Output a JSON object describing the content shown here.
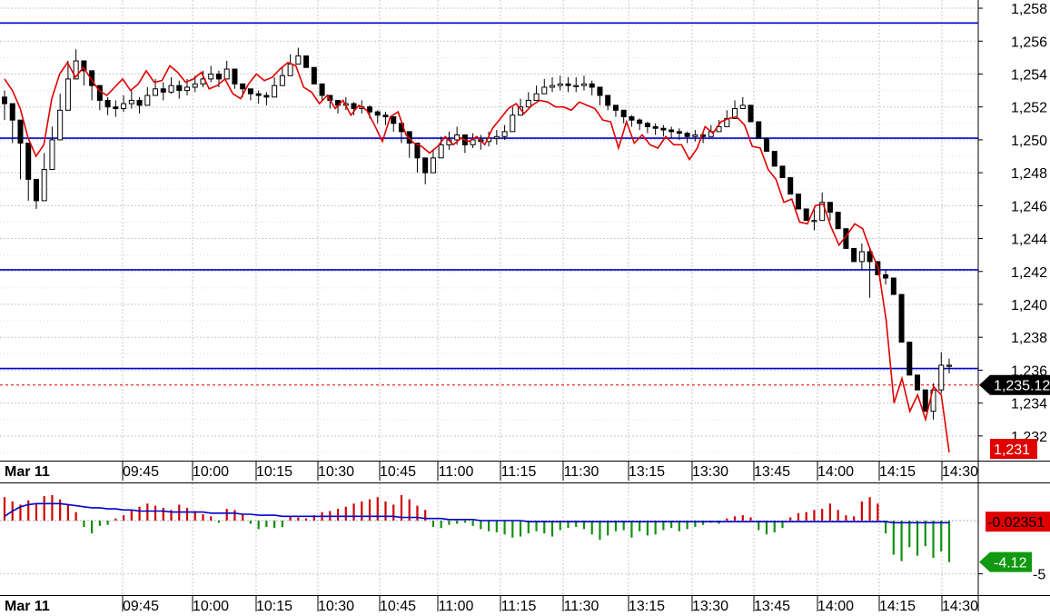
{
  "chart_data": [
    {
      "type": "candlestick",
      "panel": "price",
      "ylim": [
        1.2305,
        1.2585
      ],
      "y_ticks": [
        "1,232",
        "1,234",
        "1,236",
        "1,238",
        "1,240",
        "1,242",
        "1,244",
        "1,246",
        "1,248",
        "1,250",
        "1,252",
        "1,254",
        "1,256",
        "1,258"
      ],
      "y_tick_values": [
        1.232,
        1.234,
        1.236,
        1.238,
        1.24,
        1.242,
        1.244,
        1.246,
        1.248,
        1.25,
        1.252,
        1.254,
        1.256,
        1.258
      ],
      "x_date_label": "Mar 11",
      "x_ticks": [
        "09:45",
        "10:00",
        "10:15",
        "10:30",
        "10:45",
        "11:00",
        "11:15",
        "11:30",
        "13:15",
        "13:30",
        "13:45",
        "14:00",
        "14:15",
        "14:30"
      ],
      "grid": true,
      "horizontal_levels": [
        1.2571,
        1.2501,
        1.2421,
        1.2361
      ],
      "current_price_line": 1.2351,
      "price_badge": "1,235.12",
      "red_badge": "1,231",
      "colors": {
        "level_lines": "#0000cc",
        "overlay_line": "#e00000",
        "badge_dark": "#000000",
        "badge_red": "#e00000",
        "grid": "#c8c8c8"
      },
      "series": [
        {
          "kind": "candles",
          "close": [
            1.2522,
            1.2512,
            1.2498,
            1.2476,
            1.2463,
            1.2482,
            1.25,
            1.2518,
            1.2537,
            1.2548,
            1.2542,
            1.2533,
            1.2524,
            1.252,
            1.2519,
            1.2522,
            1.2524,
            1.2521,
            1.2527,
            1.2531,
            1.2529,
            1.2533,
            1.253,
            1.2532,
            1.2534,
            1.2537,
            1.254,
            1.2537,
            1.2543,
            1.2534,
            1.2531,
            1.2528,
            1.2527,
            1.2526,
            1.2533,
            1.2539,
            1.2546,
            1.2551,
            1.2544,
            1.2534,
            1.2527,
            1.2524,
            1.2521,
            1.2522,
            1.2519,
            1.252,
            1.2517,
            1.2515,
            1.2514,
            1.251,
            1.2505,
            1.2498,
            1.2489,
            1.248,
            1.2489,
            1.2497,
            1.25,
            1.2503,
            1.2497,
            1.25,
            1.2499,
            1.2501,
            1.2502,
            1.2505,
            1.2515,
            1.252,
            1.2524,
            1.2528,
            1.2532,
            1.2533,
            1.2534,
            1.2533,
            1.2533,
            1.2534,
            1.2532,
            1.2527,
            1.2521,
            1.2518,
            1.2514,
            1.2512,
            1.251,
            1.2508,
            1.2507,
            1.2506,
            1.2505,
            1.2504,
            1.2502,
            1.2503,
            1.2502,
            1.2505,
            1.2508,
            1.2513,
            1.2519,
            1.2521,
            1.2511,
            1.2501,
            1.2493,
            1.2484,
            1.2477,
            1.2467,
            1.2458,
            1.2451,
            1.2451,
            1.2462,
            1.2456,
            1.2446,
            1.2434,
            1.2426,
            1.2432,
            1.2426,
            1.2418,
            1.2416,
            1.2406,
            1.2377,
            1.2357,
            1.2348,
            1.2335,
            1.2348,
            1.2363,
            1.2363
          ],
          "high": [
            1.253,
            1.2522,
            1.2512,
            1.2498,
            1.2476,
            1.2492,
            1.2508,
            1.2528,
            1.2548,
            1.2555,
            1.2548,
            1.2542,
            1.2533,
            1.2526,
            1.2524,
            1.2527,
            1.253,
            1.2526,
            1.2532,
            1.2537,
            1.2535,
            1.2538,
            1.2536,
            1.2537,
            1.2539,
            1.2542,
            1.2545,
            1.2542,
            1.2548,
            1.2543,
            1.2534,
            1.2531,
            1.253,
            1.2529,
            1.2538,
            1.2544,
            1.2552,
            1.2556,
            1.2551,
            1.2544,
            1.2534,
            1.2527,
            1.2524,
            1.2526,
            1.2523,
            1.2524,
            1.2521,
            1.2518,
            1.2517,
            1.2514,
            1.251,
            1.2505,
            1.2498,
            1.2489,
            1.2494,
            1.2502,
            1.2505,
            1.2508,
            1.2503,
            1.2504,
            1.2503,
            1.2505,
            1.2506,
            1.2509,
            1.252,
            1.2525,
            1.2529,
            1.2533,
            1.2537,
            1.2538,
            1.2539,
            1.2538,
            1.2538,
            1.2539,
            1.2536,
            1.2532,
            1.2527,
            1.2521,
            1.2518,
            1.2515,
            1.2513,
            1.2511,
            1.251,
            1.2509,
            1.2508,
            1.2507,
            1.2505,
            1.2506,
            1.2505,
            1.2509,
            1.2512,
            1.2518,
            1.2524,
            1.2526,
            1.2521,
            1.2511,
            1.2501,
            1.2493,
            1.2484,
            1.2477,
            1.2467,
            1.2458,
            1.2458,
            1.2468,
            1.2462,
            1.2456,
            1.2446,
            1.2434,
            1.2437,
            1.2434,
            1.2426,
            1.2421,
            1.2416,
            1.2406,
            1.2377,
            1.2357,
            1.2348,
            1.2352,
            1.2371,
            1.2367
          ],
          "low": [
            1.2512,
            1.2498,
            1.2476,
            1.2463,
            1.2458,
            1.2463,
            1.2482,
            1.25,
            1.2518,
            1.2537,
            1.2533,
            1.2524,
            1.2518,
            1.2515,
            1.2514,
            1.2517,
            1.2519,
            1.2516,
            1.2521,
            1.2527,
            1.2524,
            1.2528,
            1.2525,
            1.2527,
            1.2529,
            1.2532,
            1.2535,
            1.2532,
            1.2537,
            1.2531,
            1.2526,
            1.2524,
            1.2522,
            1.2521,
            1.2526,
            1.2533,
            1.2539,
            1.2546,
            1.2544,
            1.2534,
            1.2524,
            1.2519,
            1.2516,
            1.2518,
            1.2515,
            1.2516,
            1.2513,
            1.251,
            1.2509,
            1.2505,
            1.2498,
            1.2489,
            1.248,
            1.2473,
            1.248,
            1.2489,
            1.2494,
            1.2497,
            1.2492,
            1.2495,
            1.2494,
            1.2496,
            1.2497,
            1.25,
            1.2505,
            1.2515,
            1.252,
            1.2524,
            1.2528,
            1.2529,
            1.253,
            1.2529,
            1.2529,
            1.253,
            1.2527,
            1.2521,
            1.2518,
            1.2514,
            1.251,
            1.2508,
            1.2506,
            1.2504,
            1.2503,
            1.2502,
            1.2501,
            1.25,
            1.2498,
            1.2499,
            1.2498,
            1.2502,
            1.2505,
            1.2508,
            1.2513,
            1.2519,
            1.2511,
            1.2501,
            1.2493,
            1.2484,
            1.2477,
            1.2467,
            1.2458,
            1.2451,
            1.2445,
            1.2451,
            1.2451,
            1.2446,
            1.2434,
            1.2426,
            1.2421,
            1.2404,
            1.2418,
            1.2412,
            1.2406,
            1.2377,
            1.2357,
            1.2348,
            1.2335,
            1.233,
            1.2346,
            1.2358
          ]
        },
        {
          "kind": "line",
          "values": [
            1.2537,
            1.253,
            1.2519,
            1.2501,
            1.249,
            1.2497,
            1.2525,
            1.254,
            1.2547,
            1.2538,
            1.2544,
            1.2537,
            1.253,
            1.2527,
            1.2532,
            1.2537,
            1.253,
            1.2534,
            1.2542,
            1.2535,
            1.2536,
            1.2545,
            1.2541,
            1.2535,
            1.2537,
            1.2541,
            1.2531,
            1.2533,
            1.2537,
            1.2528,
            1.2525,
            1.2534,
            1.254,
            1.2536,
            1.2538,
            1.2543,
            1.2547,
            1.2545,
            1.2532,
            1.2529,
            1.2522,
            1.2527,
            1.2519,
            1.2524,
            1.2515,
            1.2521,
            1.2518,
            1.2509,
            1.2499,
            1.2514,
            1.2517,
            1.2503,
            1.2498,
            1.2496,
            1.2492,
            1.2496,
            1.2502,
            1.2497,
            1.2501,
            1.2499,
            1.2502,
            1.2497,
            1.2507,
            1.2513,
            1.2519,
            1.2522,
            1.2516,
            1.2521,
            1.2524,
            1.2523,
            1.252,
            1.252,
            1.2518,
            1.2523,
            1.2521,
            1.2519,
            1.2512,
            1.2511,
            1.2495,
            1.2511,
            1.2498,
            1.2503,
            1.2497,
            1.2495,
            1.2502,
            1.2497,
            1.2497,
            1.2488,
            1.2495,
            1.2508,
            1.2504,
            1.2511,
            1.2513,
            1.2514,
            1.2509,
            1.2496,
            1.2495,
            1.2482,
            1.2476,
            1.2462,
            1.2464,
            1.245,
            1.2449,
            1.246,
            1.2461,
            1.2447,
            1.2436,
            1.2442,
            1.2449,
            1.2446,
            1.2433,
            1.2422,
            1.239,
            1.234,
            1.2355,
            1.2335,
            1.2345,
            1.233,
            1.235,
            1.2345,
            1.231
          ]
        }
      ]
    },
    {
      "type": "bar",
      "panel": "indicator",
      "ylim": [
        -7,
        3.5
      ],
      "y_ticks": [
        "-5"
      ],
      "y_tick_values": [
        -5
      ],
      "badges": [
        "-0.02351",
        "-4.12"
      ],
      "colors": {
        "positive": "#d00000",
        "negative": "#109010",
        "signal_line": "#0000cc",
        "badge_red": "#e00000",
        "badge_green": "#119911"
      },
      "x_date_label": "Mar 11",
      "x_ticks": [
        "09:45",
        "10:00",
        "10:15",
        "10:30",
        "10:45",
        "11:00",
        "11:15",
        "11:30",
        "13:15",
        "13:30",
        "13:45",
        "14:00",
        "14:15",
        "14:30"
      ],
      "values": [
        2.2,
        1.8,
        1.5,
        1.9,
        1.6,
        2.3,
        2.4,
        2.0,
        1.5,
        0.8,
        -0.6,
        -1.2,
        -0.5,
        -0.4,
        0.2,
        0.5,
        1.0,
        1.3,
        1.6,
        1.4,
        1.2,
        1.0,
        1.5,
        1.2,
        0.9,
        0.6,
        0.4,
        -0.2,
        1.1,
        1.0,
        0.6,
        -0.3,
        -0.8,
        -0.6,
        -0.7,
        -0.6,
        0.4,
        0.3,
        0.2,
        0.5,
        0.8,
        0.9,
        1.1,
        1.3,
        1.6,
        1.8,
        2.0,
        2.2,
        1.8,
        1.5,
        2.4,
        2.0,
        1.4,
        1.0,
        -0.6,
        -0.7,
        -0.4,
        -0.3,
        -0.2,
        -0.5,
        -0.8,
        -1.0,
        -1.1,
        -1.3,
        -1.6,
        -1.5,
        -1.2,
        -1.0,
        -1.2,
        -1.5,
        -0.9,
        -0.7,
        -0.6,
        -0.8,
        -1.3,
        -1.8,
        -1.4,
        -1.0,
        -0.9,
        -1.6,
        -1.0,
        -1.4,
        -1.3,
        -0.9,
        -0.7,
        -1.0,
        -0.8,
        -0.6,
        -0.4,
        -0.2,
        -0.3,
        0.2,
        0.4,
        0.5,
        0.3,
        -0.9,
        -1.3,
        -1.1,
        -0.7,
        0.3,
        0.7,
        0.8,
        1.0,
        1.1,
        1.6,
        1.0,
        0.5,
        0.4,
        1.8,
        2.2,
        1.6,
        -1.2,
        -3.2,
        -3.8,
        -2.5,
        -3.3,
        -2.4,
        -3.5,
        -2.9,
        -3.9
      ],
      "signal": [
        0.4,
        0.9,
        1.3,
        1.5,
        1.6,
        1.6,
        1.6,
        1.6,
        1.5,
        1.4,
        1.3,
        1.2,
        1.2,
        1.1,
        1.1,
        1.0,
        1.0,
        0.9,
        0.9,
        0.9,
        0.9,
        0.8,
        0.8,
        0.8,
        0.8,
        0.8,
        0.7,
        0.7,
        0.7,
        0.7,
        0.6,
        0.6,
        0.5,
        0.5,
        0.5,
        0.4,
        0.4,
        0.4,
        0.4,
        0.4,
        0.4,
        0.4,
        0.4,
        0.4,
        0.4,
        0.4,
        0.4,
        0.4,
        0.4,
        0.4,
        0.3,
        0.3,
        0.3,
        0.2,
        0.2,
        0.2,
        0.1,
        0.1,
        0.1,
        0.1,
        0.0,
        0.0,
        0.0,
        0.0,
        0.0,
        0.0,
        -0.1,
        -0.1,
        -0.1,
        -0.1,
        -0.1,
        -0.1,
        -0.1,
        -0.1,
        -0.1,
        -0.1,
        -0.1,
        -0.1,
        -0.1,
        -0.1,
        -0.1,
        -0.1,
        -0.1,
        -0.1,
        -0.1,
        -0.1,
        -0.1,
        -0.1,
        -0.1,
        -0.1,
        -0.1,
        -0.1,
        -0.1,
        -0.1,
        -0.1,
        -0.1,
        -0.1,
        -0.1,
        -0.1,
        -0.1,
        -0.1,
        -0.1,
        -0.1,
        -0.1,
        -0.1,
        -0.1,
        -0.1,
        -0.1,
        -0.1,
        -0.1,
        -0.1,
        -0.1,
        -0.2,
        -0.2,
        -0.2,
        -0.2,
        -0.2,
        -0.2,
        -0.2,
        -0.2
      ]
    }
  ]
}
